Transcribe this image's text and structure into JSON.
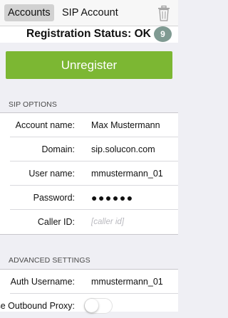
{
  "topbar": {
    "tab_accounts": "Accounts",
    "tab_sip": "SIP Account",
    "delete_icon": "trash-icon"
  },
  "status": {
    "text": "Registration Status: OK",
    "badge": "9",
    "badge_color": "#7f9a92"
  },
  "unregister_button": {
    "label": "Unregister",
    "color": "#7cb733"
  },
  "sip_options": {
    "header": "SIP OPTIONS",
    "rows": [
      {
        "label": "Account name:",
        "value": "Max Mustermann"
      },
      {
        "label": "Domain:",
        "value": "sip.solucon.com"
      },
      {
        "label": "User name:",
        "value": "mmustermann_01"
      },
      {
        "label": "Password:",
        "value": "●●●●●●"
      },
      {
        "label": "Caller ID:",
        "placeholder": "[caller id]"
      }
    ]
  },
  "advanced_settings": {
    "header": "ADVANCED SETTINGS",
    "rows": [
      {
        "label": "Auth Username:",
        "value": "mmustermann_01"
      },
      {
        "label": "Use Outbound Proxy:",
        "toggle_on": false
      }
    ]
  }
}
